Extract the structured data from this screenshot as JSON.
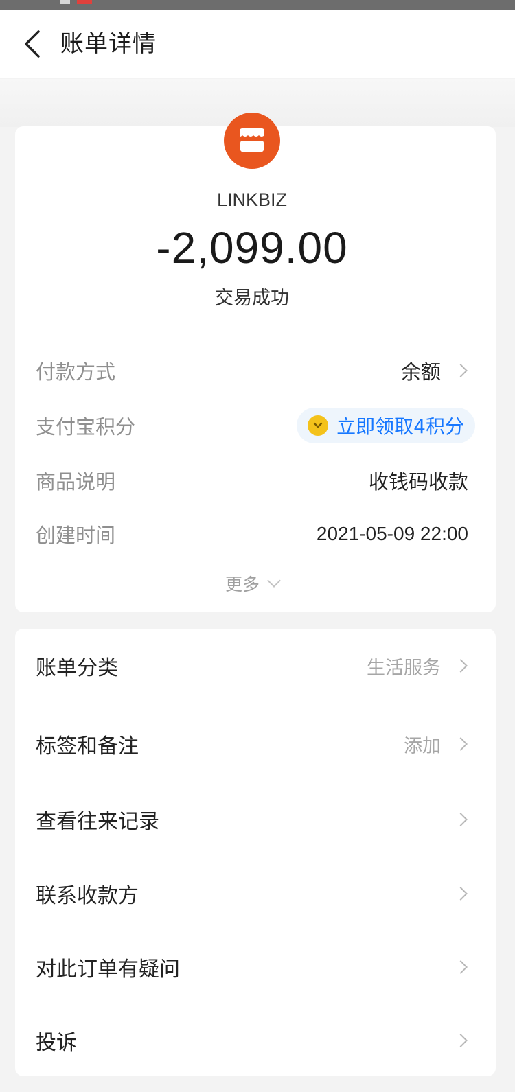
{
  "nav": {
    "title": "账单详情"
  },
  "merchant": {
    "name": "LINKBIZ",
    "amount": "-2,099.00",
    "status": "交易成功",
    "logo_color": "#e9561f"
  },
  "details": {
    "payment_method": {
      "label": "付款方式",
      "value": "余额"
    },
    "points": {
      "label": "支付宝积分",
      "value": "立即领取4积分",
      "accent": "#1677ff"
    },
    "product_desc": {
      "label": "商品说明",
      "value": "收钱码收款"
    },
    "created_time": {
      "label": "创建时间",
      "value": "2021-05-09 22:00"
    },
    "more": "更多"
  },
  "menu": {
    "category": {
      "label": "账单分类",
      "value": "生活服务"
    },
    "tags": {
      "label": "标签和备注",
      "value": "添加"
    },
    "history": {
      "label": "查看往来记录"
    },
    "contact": {
      "label": "联系收款方"
    },
    "question": {
      "label": "对此订单有疑问"
    },
    "complaint": {
      "label": "投诉"
    }
  }
}
